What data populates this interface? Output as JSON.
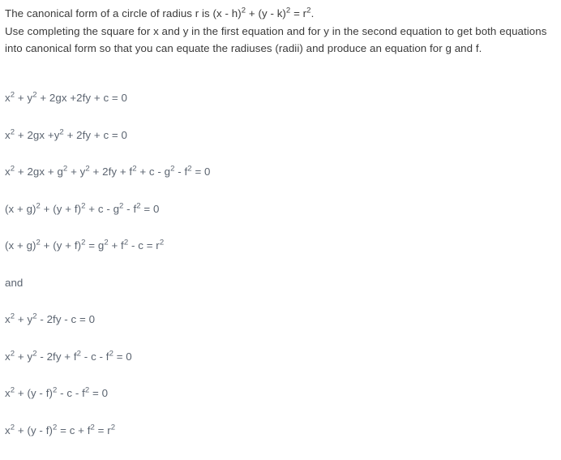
{
  "page": {
    "background_color": "#ffffff",
    "body_text_color": "#3a3a3a",
    "equation_text_color": "#5b6470"
  },
  "intro": {
    "line1_part1": "The canonical form of a circle of radius r is (x - h)",
    "line1_sup1": "2",
    "line1_part2": " + (y - k)",
    "line1_sup2": "2",
    "line1_part3": " = r",
    "line1_sup3": "2",
    "line1_part4": ".",
    "paragraph": "Use completing the square for x and y in the first equation and for y in the second equation to get both equations into canonical form so that you can equate the radiuses (radii) and produce an equation for g and f."
  },
  "equations": [
    {
      "id": "eq-1",
      "text": "x2 + y2 + 2gx +2fy + c = 0",
      "parts": [
        {
          "t": "x"
        },
        {
          "s": "2"
        },
        {
          "t": " + y"
        },
        {
          "s": "2"
        },
        {
          "t": " + 2gx +2fy + c = 0"
        }
      ]
    },
    {
      "id": "eq-2",
      "text": "x2 + 2gx +y2 + 2fy + c = 0",
      "parts": [
        {
          "t": "x"
        },
        {
          "s": "2"
        },
        {
          "t": " + 2gx +y"
        },
        {
          "s": "2"
        },
        {
          "t": " + 2fy + c = 0"
        }
      ]
    },
    {
      "id": "eq-3",
      "text": "x2 + 2gx + g2 + y2 + 2fy + f2 + c - g2 - f2 = 0",
      "parts": [
        {
          "t": "x"
        },
        {
          "s": "2"
        },
        {
          "t": " + 2gx + g"
        },
        {
          "s": "2"
        },
        {
          "t": " + y"
        },
        {
          "s": "2"
        },
        {
          "t": " + 2fy + f"
        },
        {
          "s": "2"
        },
        {
          "t": " + c - g"
        },
        {
          "s": "2"
        },
        {
          "t": " - f"
        },
        {
          "s": "2"
        },
        {
          "t": " = 0"
        }
      ]
    },
    {
      "id": "eq-4",
      "text": "(x + g)2 + (y + f)2 + c - g2 - f2 = 0",
      "parts": [
        {
          "t": "(x + g)"
        },
        {
          "s": "2"
        },
        {
          "t": " + (y + f)"
        },
        {
          "s": "2"
        },
        {
          "t": " + c - g"
        },
        {
          "s": "2"
        },
        {
          "t": " - f"
        },
        {
          "s": "2"
        },
        {
          "t": " = 0"
        }
      ]
    },
    {
      "id": "eq-5",
      "text": "(x + g)2 + (y + f)2 = g2 + f2 - c = r2",
      "parts": [
        {
          "t": "(x + g)"
        },
        {
          "s": "2"
        },
        {
          "t": " + (y + f)"
        },
        {
          "s": "2"
        },
        {
          "t": " = g"
        },
        {
          "s": "2"
        },
        {
          "t": " + f"
        },
        {
          "s": "2"
        },
        {
          "t": " - c = r"
        },
        {
          "s": "2"
        }
      ]
    },
    {
      "id": "connector",
      "text": "and",
      "parts": [
        {
          "t": "and"
        }
      ]
    },
    {
      "id": "eq-6",
      "text": "x2 + y2 - 2fy - c = 0",
      "parts": [
        {
          "t": "x"
        },
        {
          "s": "2"
        },
        {
          "t": " + y"
        },
        {
          "s": "2"
        },
        {
          "t": " - 2fy - c = 0"
        }
      ]
    },
    {
      "id": "eq-7",
      "text": "x2 + y2 - 2fy + f2 - c - f2 = 0",
      "parts": [
        {
          "t": "x"
        },
        {
          "s": "2"
        },
        {
          "t": " + y"
        },
        {
          "s": "2"
        },
        {
          "t": " - 2fy + f"
        },
        {
          "s": "2"
        },
        {
          "t": " - c - f"
        },
        {
          "s": "2"
        },
        {
          "t": " = 0"
        }
      ]
    },
    {
      "id": "eq-8",
      "text": "x2 + (y - f)2 - c - f2 = 0",
      "parts": [
        {
          "t": "x"
        },
        {
          "s": "2"
        },
        {
          "t": " + (y - f)"
        },
        {
          "s": "2"
        },
        {
          "t": " - c - f"
        },
        {
          "s": "2"
        },
        {
          "t": " = 0"
        }
      ]
    },
    {
      "id": "eq-9",
      "text": "x2 + (y - f)2 = c + f2 = r2",
      "parts": [
        {
          "t": "x"
        },
        {
          "s": "2"
        },
        {
          "t": " + (y - f)"
        },
        {
          "s": "2"
        },
        {
          "t": " = c + f"
        },
        {
          "s": "2"
        },
        {
          "t": " = r"
        },
        {
          "s": "2"
        }
      ]
    }
  ]
}
